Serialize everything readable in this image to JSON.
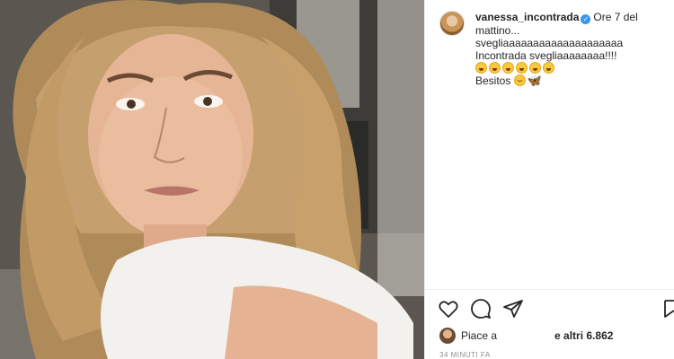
{
  "post": {
    "username": "vanessa_incontrada",
    "caption_lines": [
      "Ore 7 del mattino...",
      "svegliaaaaaaaaaaaaaaaaaaaa",
      "Incontrada svegliaaaaaaaa!!!!",
      "Besitos"
    ],
    "emoji_row": [
      "grinning-face",
      "grinning-face",
      "grinning-face",
      "grinning-face",
      "grinning-face",
      "grinning-face"
    ],
    "besitos_emojis": [
      "smiling-face",
      "butterfly"
    ],
    "likes_prefix": "Piace a",
    "likes_suffix": "e altri 6.862",
    "timestamp": "34 MINUTI FA"
  },
  "icons": {
    "like": "heart-icon",
    "comment": "comment-icon",
    "share": "send-icon",
    "save": "bookmark-icon",
    "verified": "verified-badge-icon"
  },
  "colors": {
    "verified": "#3897f0",
    "text": "#262626",
    "muted": "#8e8e8e"
  }
}
